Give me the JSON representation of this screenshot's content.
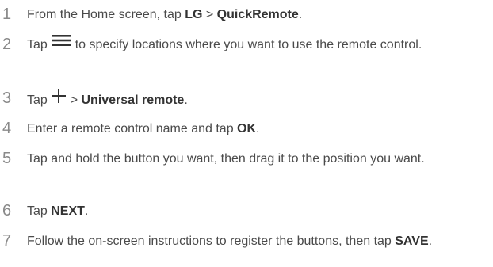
{
  "steps": [
    {
      "num": "1",
      "parts": [
        {
          "t": "text",
          "v": "From the Home screen, tap "
        },
        {
          "t": "bold",
          "v": "LG"
        },
        {
          "t": "text",
          "v": " > "
        },
        {
          "t": "bold",
          "v": "QuickRemote"
        },
        {
          "t": "text",
          "v": "."
        }
      ]
    },
    {
      "num": "2",
      "parts": [
        {
          "t": "text",
          "v": "Tap "
        },
        {
          "t": "icon",
          "v": "menu-icon"
        },
        {
          "t": "text",
          "v": " to specify locations where you want to use the remote control."
        }
      ]
    },
    {
      "num": "3",
      "parts": [
        {
          "t": "text",
          "v": "Tap "
        },
        {
          "t": "icon",
          "v": "plus-icon"
        },
        {
          "t": "text",
          "v": " > "
        },
        {
          "t": "bold",
          "v": "Universal remote"
        },
        {
          "t": "text",
          "v": "."
        }
      ]
    },
    {
      "num": "4",
      "parts": [
        {
          "t": "text",
          "v": "Enter a remote control name and tap "
        },
        {
          "t": "bold",
          "v": "OK"
        },
        {
          "t": "text",
          "v": "."
        }
      ]
    },
    {
      "num": "5",
      "parts": [
        {
          "t": "text",
          "v": "Tap and hold the button you want, then drag it to the position you want."
        }
      ]
    },
    {
      "num": "6",
      "parts": [
        {
          "t": "text",
          "v": "Tap "
        },
        {
          "t": "bold",
          "v": "NEXT"
        },
        {
          "t": "text",
          "v": "."
        }
      ]
    },
    {
      "num": "7",
      "parts": [
        {
          "t": "text",
          "v": "Follow the on-screen instructions to register the buttons, then tap "
        },
        {
          "t": "bold",
          "v": "SAVE"
        },
        {
          "t": "text",
          "v": "."
        }
      ]
    }
  ]
}
